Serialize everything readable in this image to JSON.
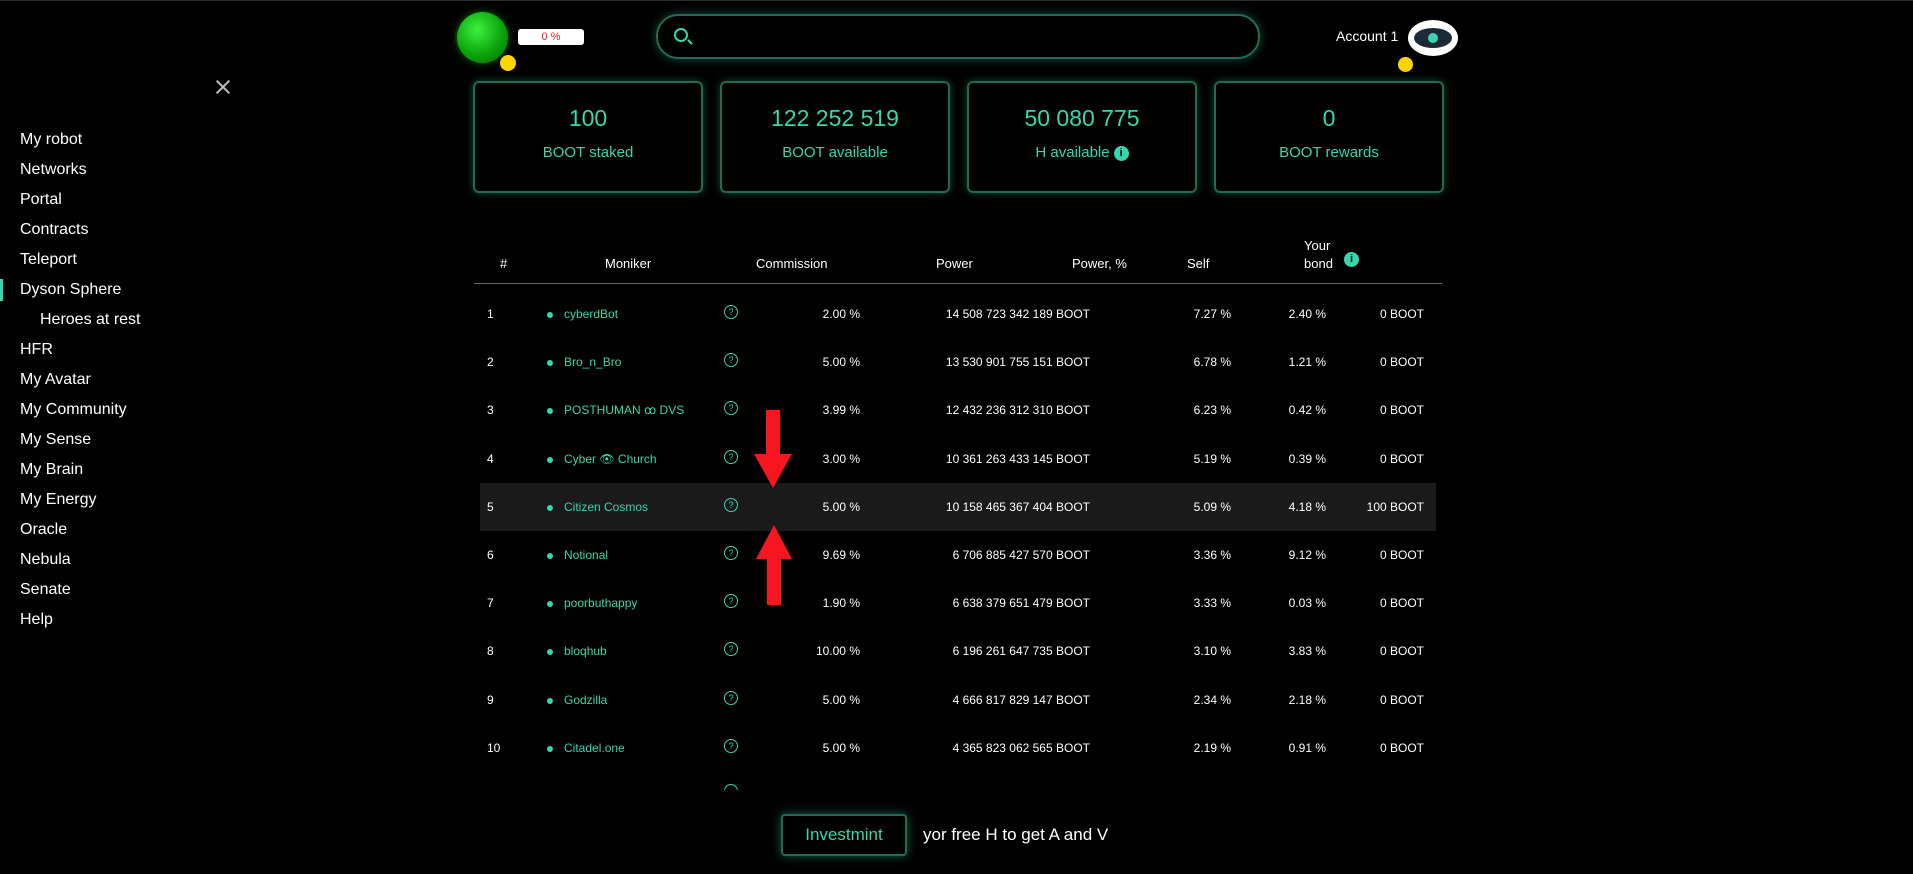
{
  "header": {
    "progress_text": "0 %",
    "search": {
      "placeholder": "",
      "value": ""
    },
    "account_name": "Account 1"
  },
  "sidebar": {
    "items": [
      {
        "label": "My robot"
      },
      {
        "label": "Networks"
      },
      {
        "label": "Portal"
      },
      {
        "label": "Contracts"
      },
      {
        "label": "Teleport"
      },
      {
        "label": "Dyson Sphere",
        "active": true
      },
      {
        "label": "Heroes at rest",
        "sub": true
      },
      {
        "label": "HFR"
      },
      {
        "label": "My Avatar"
      },
      {
        "label": "My Community"
      },
      {
        "label": "My Sense"
      },
      {
        "label": "My Brain"
      },
      {
        "label": "My Energy"
      },
      {
        "label": "Oracle"
      },
      {
        "label": "Nebula"
      },
      {
        "label": "Senate"
      },
      {
        "label": "Help"
      }
    ]
  },
  "stats": [
    {
      "value": "100",
      "label": "BOOT staked"
    },
    {
      "value": "122 252 519",
      "label": "BOOT available"
    },
    {
      "value": "50 080 775",
      "label": "H available",
      "info": "i"
    },
    {
      "value": "0",
      "label": "BOOT rewards"
    }
  ],
  "table": {
    "headers": {
      "num": "#",
      "moniker": "Moniker",
      "commission": "Commission",
      "power": "Power",
      "power_pct": "Power, %",
      "self": "Self",
      "bond_line1": "Your",
      "bond_line2": "bond",
      "bond_info": "i"
    },
    "help_glyph": "?",
    "rows": [
      {
        "num": "1",
        "moniker": "cyberdBot",
        "commission": "2.00  %",
        "power": "14 508 723 342 189  BOOT",
        "power_pct": "7.27  %",
        "self": "2.40  %",
        "bond": "0 BOOT"
      },
      {
        "num": "2",
        "moniker": "Bro_n_Bro",
        "commission": "5.00  %",
        "power": "13 530 901 755 151  BOOT",
        "power_pct": "6.78  %",
        "self": "1.21  %",
        "bond": "0 BOOT"
      },
      {
        "num": "3",
        "moniker": "POSTHUMAN ꝏ DVS",
        "commission": "3.99  %",
        "power": "12 432 236 312 310  BOOT",
        "power_pct": "6.23  %",
        "self": "0.42  %",
        "bond": "0 BOOT"
      },
      {
        "num": "4",
        "moniker": "Cyber 👁 Church",
        "commission": "3.00  %",
        "power": "10 361 263 433 145  BOOT",
        "power_pct": "5.19  %",
        "self": "0.39  %",
        "bond": "0 BOOT"
      },
      {
        "num": "5",
        "moniker": "Citizen Cosmos",
        "commission": "5.00  %",
        "power": "10 158 465 367 404  BOOT",
        "power_pct": "5.09  %",
        "self": "4.18  %",
        "bond": "100 BOOT",
        "highlighted": true
      },
      {
        "num": "6",
        "moniker": "Notional",
        "commission": "9.69  %",
        "power": "6 706 885 427 570  BOOT",
        "power_pct": "3.36  %",
        "self": "9.12  %",
        "bond": "0 BOOT"
      },
      {
        "num": "7",
        "moniker": "poorbuthappy",
        "commission": "1.90  %",
        "power": "6 638 379 651 479  BOOT",
        "power_pct": "3.33  %",
        "self": "0.03  %",
        "bond": "0 BOOT"
      },
      {
        "num": "8",
        "moniker": "bloqhub",
        "commission": "10.00  %",
        "power": "6 196 261 647 735  BOOT",
        "power_pct": "3.10  %",
        "self": "3.83  %",
        "bond": "0 BOOT"
      },
      {
        "num": "9",
        "moniker": "Godzilla",
        "commission": "5.00  %",
        "power": "4 666 817 829 147  BOOT",
        "power_pct": "2.34  %",
        "self": "2.18  %",
        "bond": "0 BOOT"
      },
      {
        "num": "10",
        "moniker": "Citadel.one",
        "commission": "5.00  %",
        "power": "4 365 823 062 565  BOOT",
        "power_pct": "2.19  %",
        "self": "0.91  %",
        "bond": "0 BOOT"
      }
    ]
  },
  "bottom": {
    "button_label": "Investmint",
    "hint_text": "yor free H to get A and V"
  },
  "colors": {
    "accent": "#36d6ae",
    "border": "#1f6b55",
    "arrow": "#f5161f",
    "highlight_row": "#1a1a1a"
  }
}
